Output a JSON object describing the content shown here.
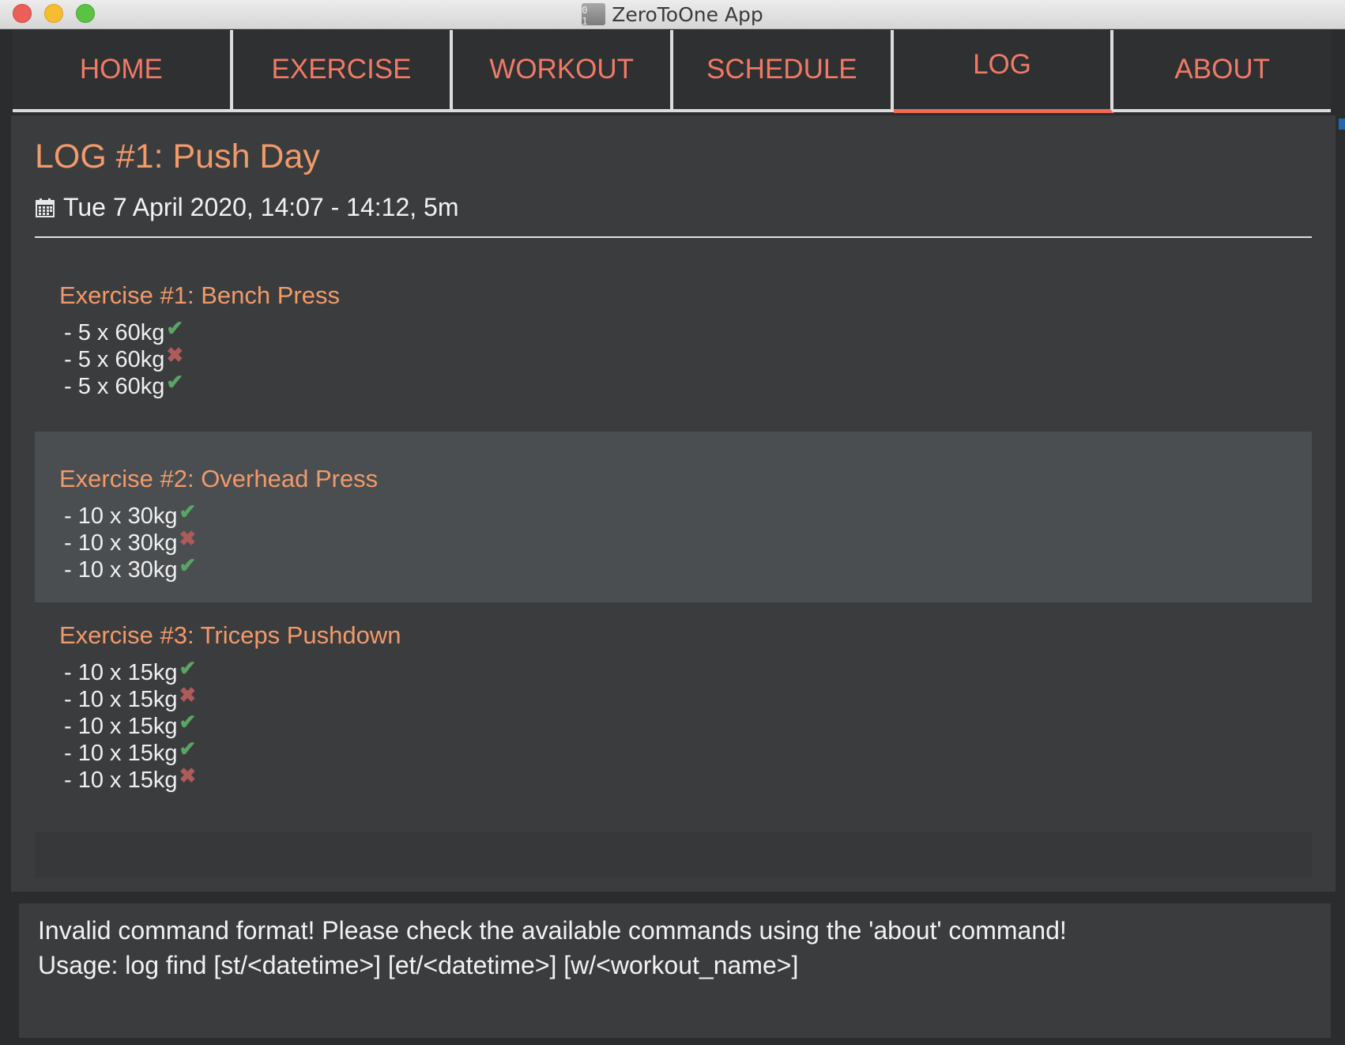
{
  "window": {
    "title": "ZeroToOne App",
    "icon_text": "0 1",
    "controls": [
      "close",
      "minimize",
      "maximize"
    ]
  },
  "tabs": [
    {
      "label": "HOME",
      "active": false
    },
    {
      "label": "EXERCISE",
      "active": false
    },
    {
      "label": "WORKOUT",
      "active": false
    },
    {
      "label": "SCHEDULE",
      "active": false
    },
    {
      "label": "LOG",
      "active": true
    },
    {
      "label": "ABOUT",
      "active": false
    }
  ],
  "log": {
    "title": "LOG #1: Push Day",
    "date_icon": "calendar-icon",
    "date": "Tue 7 April 2020,  14:07 - 14:12, 5m",
    "exercises": [
      {
        "title": "Exercise #1: Bench Press",
        "sets": [
          {
            "text": "- 5 x 60kg",
            "done": true
          },
          {
            "text": "- 5 x 60kg",
            "done": false
          },
          {
            "text": "- 5 x 60kg",
            "done": true
          }
        ]
      },
      {
        "title": "Exercise #2: Overhead Press",
        "sets": [
          {
            "text": "- 10 x 30kg",
            "done": true
          },
          {
            "text": "- 10 x 30kg",
            "done": false
          },
          {
            "text": "- 10 x 30kg",
            "done": true
          }
        ]
      },
      {
        "title": "Exercise #3: Triceps Pushdown",
        "sets": [
          {
            "text": "- 10 x 15kg",
            "done": true
          },
          {
            "text": "- 10 x 15kg",
            "done": false
          },
          {
            "text": "- 10 x 15kg",
            "done": true
          },
          {
            "text": "- 10 x 15kg",
            "done": true
          },
          {
            "text": "- 10 x 15kg",
            "done": false
          }
        ]
      }
    ]
  },
  "result": {
    "line1": "Invalid command format! Please check the available commands using the 'about' command!",
    "line2": "Usage: log find [st/<datetime>] [et/<datetime>] [w/<workout_name>]"
  },
  "colors": {
    "accent": "#f0695a",
    "heading": "#f19a6a",
    "check": "#5aa564",
    "cross": "#b05a5a"
  }
}
